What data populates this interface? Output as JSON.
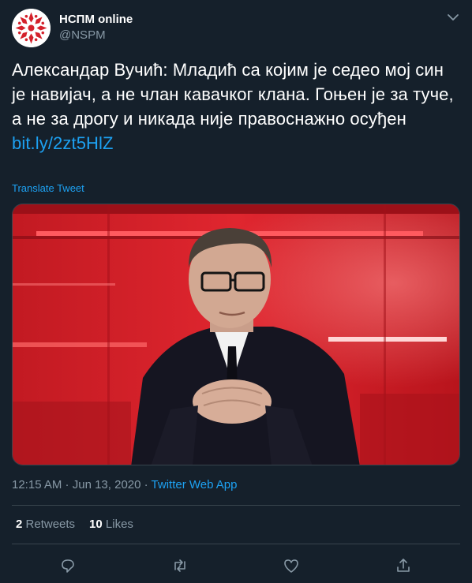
{
  "account": {
    "name": "НСПМ online",
    "handle": "@NSPM",
    "avatar_icon": "nspm-logo-icon",
    "menu_icon": "chevron-down-icon"
  },
  "tweet": {
    "text": "Александар Вучић: Младић са којим је седео мој син је навијач, а не члан кавачког клана. Гоњен је за туче, а не за дрогу и никада није правоснажно осуђен",
    "link": "bit.ly/2zt5HlZ",
    "translate_label": "Translate Tweet",
    "image_icon": "tweet-photo"
  },
  "meta": {
    "time": "12:15 AM",
    "separator": " · ",
    "date": "Jun 13, 2020",
    "source": "Twitter Web App"
  },
  "stats": {
    "retweets_count": "2",
    "retweets_label": "Retweets",
    "likes_count": "10",
    "likes_label": "Likes"
  },
  "actions": {
    "icons": [
      "reply-icon",
      "retweet-icon",
      "like-icon",
      "share-icon"
    ]
  },
  "colors": {
    "background": "#15202b",
    "accent": "#1da1f2",
    "muted": "#8899a6",
    "border": "#38444d"
  }
}
